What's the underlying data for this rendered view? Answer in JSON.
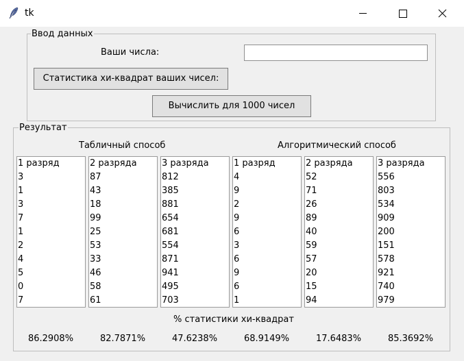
{
  "window": {
    "title": "tk"
  },
  "input_group": {
    "label": "Ввод данных",
    "numbers_label": "Ваши числа:",
    "numbers_value": "",
    "stats_button": "Статистика хи-квадрат ваших чисел:",
    "compute_button": "Вычислить для 1000 чисел"
  },
  "result_group": {
    "label": "Результат",
    "table_method_label": "Табличный способ",
    "algo_method_label": "Алгоритмический способ",
    "stats_caption": "% статистики хи-квадрат",
    "lists": [
      [
        "1 разряд",
        "3",
        "1",
        "3",
        "7",
        "1",
        "2",
        "4",
        "5",
        "0",
        "7"
      ],
      [
        "2 разряда",
        "87",
        "43",
        "18",
        "99",
        "25",
        "53",
        "33",
        "46",
        "58",
        "61"
      ],
      [
        "3 разряда",
        "812",
        "385",
        "881",
        "654",
        "681",
        "554",
        "871",
        "941",
        "495",
        "703"
      ],
      [
        "1 разряд",
        "4",
        "9",
        "2",
        "9",
        "6",
        "3",
        "6",
        "9",
        "6",
        "1"
      ],
      [
        "2 разряда",
        "52",
        "71",
        "26",
        "89",
        "40",
        "59",
        "57",
        "20",
        "15",
        "94"
      ],
      [
        "3 разряда",
        "556",
        "803",
        "534",
        "909",
        "200",
        "151",
        "578",
        "921",
        "740",
        "979"
      ]
    ],
    "percentages": [
      "86.2908%",
      "82.7871%",
      "47.6238%",
      "68.9149%",
      "17.6483%",
      "85.3692%"
    ]
  }
}
